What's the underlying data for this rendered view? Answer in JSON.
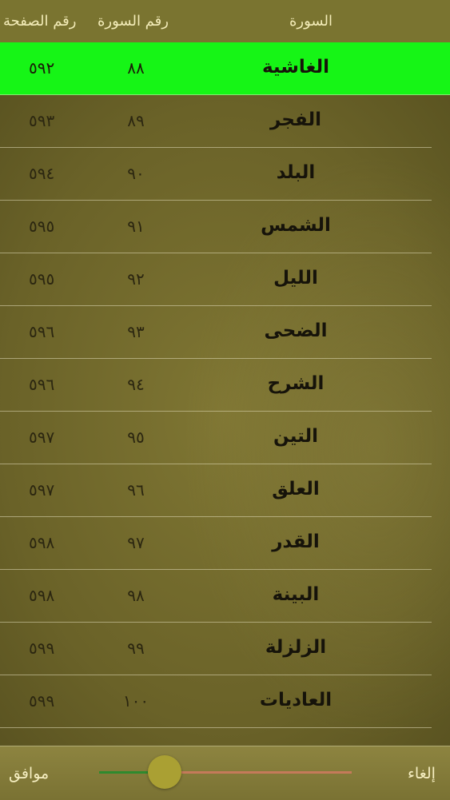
{
  "header": {
    "page_col": "رقم الصفحة",
    "number_col": "رقم السورة",
    "name_col": "السورة"
  },
  "surahs": [
    {
      "page": "٥٩٢",
      "number": "٨٨",
      "name": "الغاشية",
      "selected": true
    },
    {
      "page": "٥٩٣",
      "number": "٨٩",
      "name": "الفجر"
    },
    {
      "page": "٥٩٤",
      "number": "٩٠",
      "name": "البلد"
    },
    {
      "page": "٥٩٥",
      "number": "٩١",
      "name": "الشمس"
    },
    {
      "page": "٥٩٥",
      "number": "٩٢",
      "name": "الليل"
    },
    {
      "page": "٥٩٦",
      "number": "٩٣",
      "name": "الضحى"
    },
    {
      "page": "٥٩٦",
      "number": "٩٤",
      "name": "الشرح"
    },
    {
      "page": "٥٩٧",
      "number": "٩٥",
      "name": "التين"
    },
    {
      "page": "٥٩٧",
      "number": "٩٦",
      "name": "العلق"
    },
    {
      "page": "٥٩٨",
      "number": "٩٧",
      "name": "القدر"
    },
    {
      "page": "٥٩٨",
      "number": "٩٨",
      "name": "البينة"
    },
    {
      "page": "٥٩٩",
      "number": "٩٩",
      "name": "الزلزلة"
    },
    {
      "page": "٥٩٩",
      "number": "١٠٠",
      "name": "العاديات"
    }
  ],
  "footer": {
    "ok_label": "موافق",
    "cancel_label": "إلغاء",
    "slider_value": 0.26
  },
  "colors": {
    "selected_row": "#16f516",
    "slider_min_track": "#2e8a2e",
    "slider_max_track": "#c57a5a",
    "slider_thumb": "#aaa033"
  }
}
